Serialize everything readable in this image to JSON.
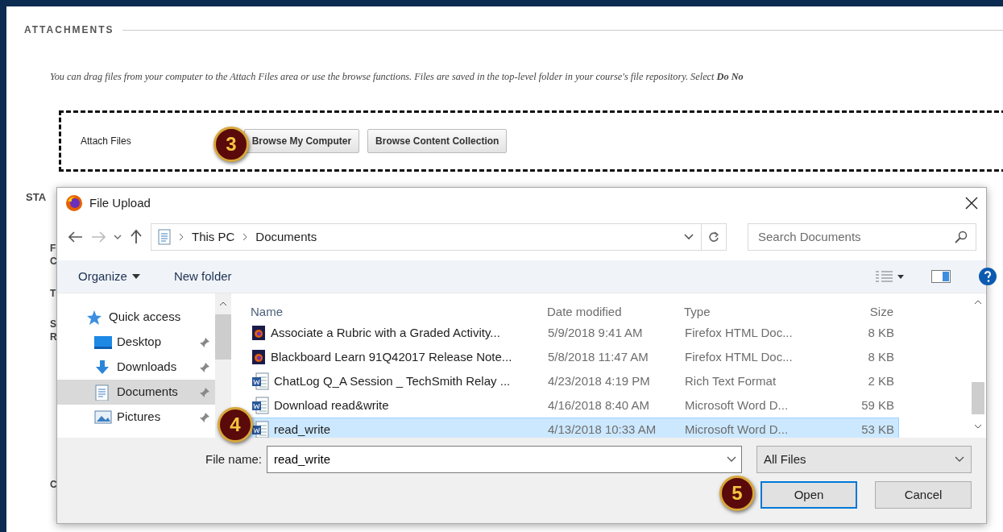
{
  "page": {
    "section_title": "ATTACHMENTS",
    "instructions": "You can drag files from your computer to the Attach Files area or use the browse functions. Files are saved in the top-level folder in your course's file repository.  Select **Do No**",
    "attach_label": "Attach Files",
    "buttons": [
      "Browse My Computer",
      "Browse Content Collection"
    ],
    "fragments": [
      "STA",
      "F",
      "C",
      "T",
      "S",
      "R",
      "C"
    ]
  },
  "callouts": [
    "3",
    "4",
    "5"
  ],
  "dialog": {
    "title": "File Upload",
    "breadcrumb": [
      "This PC",
      "Documents"
    ],
    "search": {
      "placeholder": "Search Documents"
    },
    "toolbar": [
      "Organize",
      "New folder"
    ],
    "nav": [
      {
        "label": "Quick access",
        "kind": "star",
        "selected": false,
        "pinned": false
      },
      {
        "label": "Desktop",
        "kind": "desktop",
        "selected": false,
        "pinned": true
      },
      {
        "label": "Downloads",
        "kind": "download",
        "selected": false,
        "pinned": true
      },
      {
        "label": "Documents",
        "kind": "document",
        "selected": true,
        "pinned": true
      },
      {
        "label": "Pictures",
        "kind": "picture",
        "selected": false,
        "pinned": true
      }
    ],
    "columns": [
      "Name",
      "Date modified",
      "Type",
      "Size"
    ],
    "files": [
      {
        "name": "Associate a Rubric with a Graded Activity...",
        "date": "5/9/2018 9:41 AM",
        "type": "Firefox HTML Doc...",
        "size": "8 KB",
        "kind": "firefox",
        "selected": false
      },
      {
        "name": "Blackboard Learn 91Q42017 Release Note...",
        "date": "5/8/2018 11:47 AM",
        "type": "Firefox HTML Doc...",
        "size": "8 KB",
        "kind": "firefox",
        "selected": false
      },
      {
        "name": "ChatLog Q_A Session _ TechSmith Relay ...",
        "date": "4/23/2018 4:19 PM",
        "type": "Rich Text Format",
        "size": "2 KB",
        "kind": "word",
        "selected": false
      },
      {
        "name": "Download read&write",
        "date": "4/16/2018 8:40 AM",
        "type": "Microsoft Word D...",
        "size": "59 KB",
        "kind": "word",
        "selected": false
      },
      {
        "name": "read_write",
        "date": "4/13/2018 10:33 AM",
        "type": "Microsoft Word D...",
        "size": "53 KB",
        "kind": "word",
        "selected": true
      }
    ],
    "file_name_label": "File name:",
    "file_name": "read_write",
    "filter": "All Files",
    "buttons": [
      {
        "label": "Open",
        "default": true
      },
      {
        "label": "Cancel",
        "default": false
      }
    ]
  }
}
